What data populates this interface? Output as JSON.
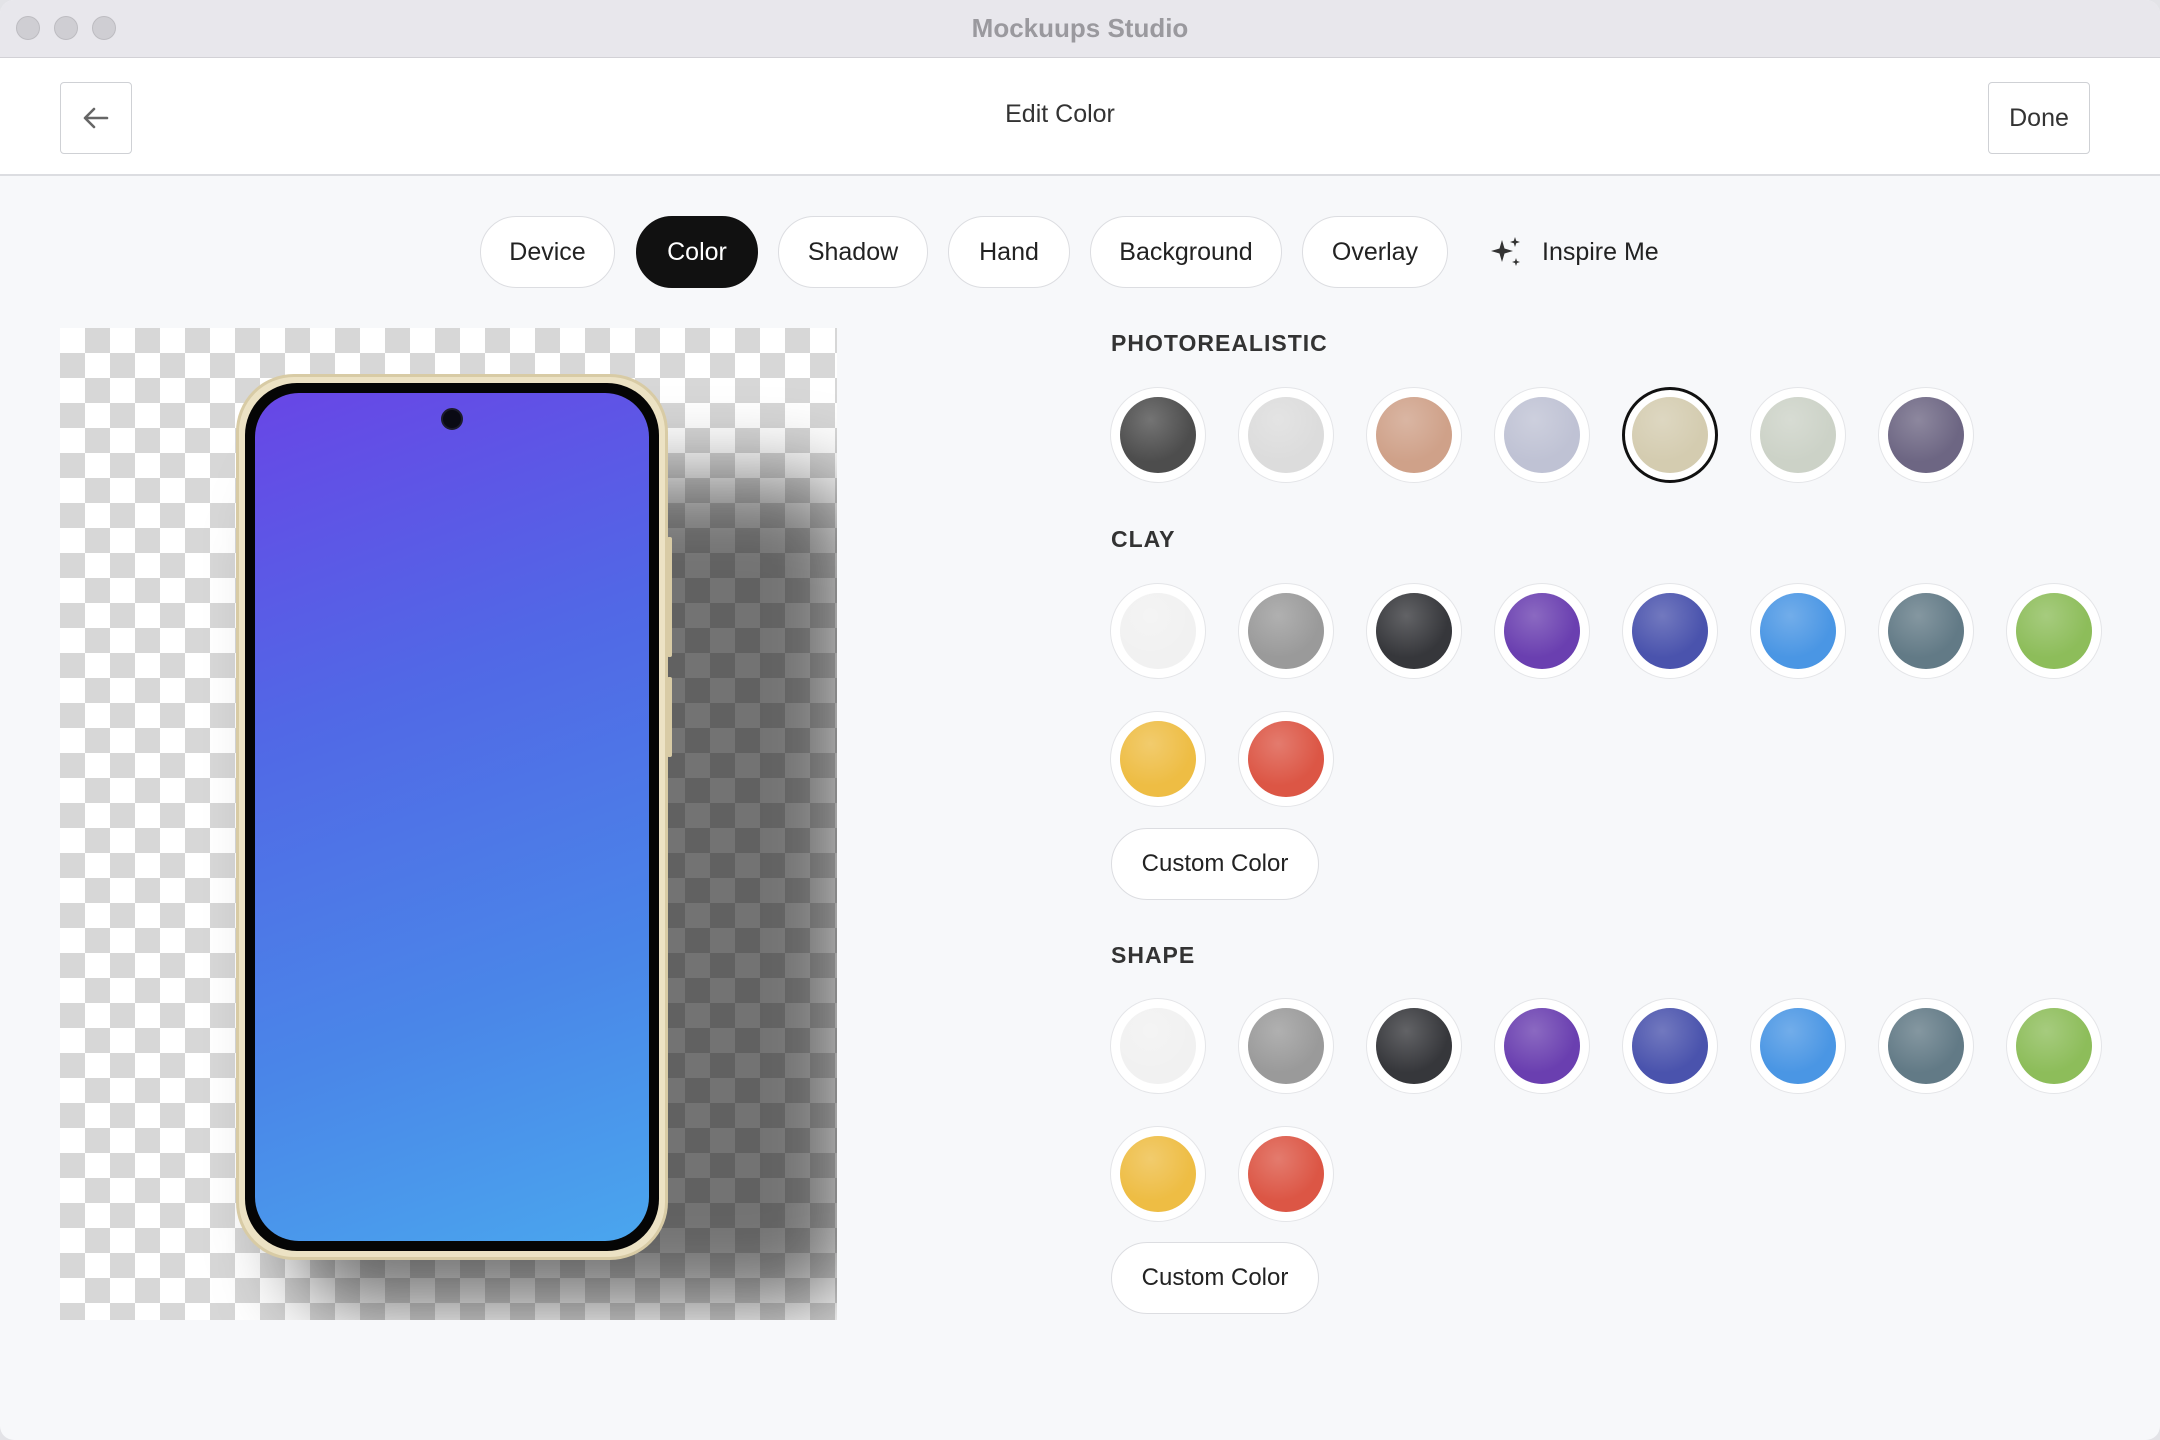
{
  "window": {
    "title": "Mockuups Studio"
  },
  "header": {
    "title": "Edit Color",
    "done_label": "Done"
  },
  "tabs": [
    {
      "label": "Device"
    },
    {
      "label": "Color",
      "active": true
    },
    {
      "label": "Shadow"
    },
    {
      "label": "Hand"
    },
    {
      "label": "Background"
    },
    {
      "label": "Overlay"
    }
  ],
  "inspire": {
    "label": "Inspire Me",
    "icon": "sparkles-icon"
  },
  "preview": {
    "device": "smartphone",
    "screen_gradient": [
      "#6846e6",
      "#4aa6ee"
    ],
    "frame_color": "#ece2c4"
  },
  "sections": {
    "photorealistic": {
      "label": "PHOTOREALISTIC",
      "swatches": [
        "#4d4d4d",
        "#dcdcdc",
        "#cfa189",
        "#bfc2d4",
        "#d4ccb0",
        "#ccd2c7",
        "#6d6683"
      ],
      "selected_index": 4
    },
    "clay": {
      "label": "CLAY",
      "swatches": [
        "#f1f1f1",
        "#9a9a9a",
        "#36373b",
        "#6a3fb0",
        "#4a53ad",
        "#4a96e4",
        "#627a86",
        "#8dbd5a",
        "#eebd44",
        "#dc5645"
      ],
      "custom_label": "Custom Color"
    },
    "shape": {
      "label": "SHAPE",
      "swatches": [
        "#f1f1f1",
        "#9a9a9a",
        "#36373b",
        "#6a3fb0",
        "#4a53ad",
        "#4a96e4",
        "#627a86",
        "#8dbd5a",
        "#eebd44",
        "#dc5645"
      ],
      "custom_label": "Custom Color"
    }
  }
}
